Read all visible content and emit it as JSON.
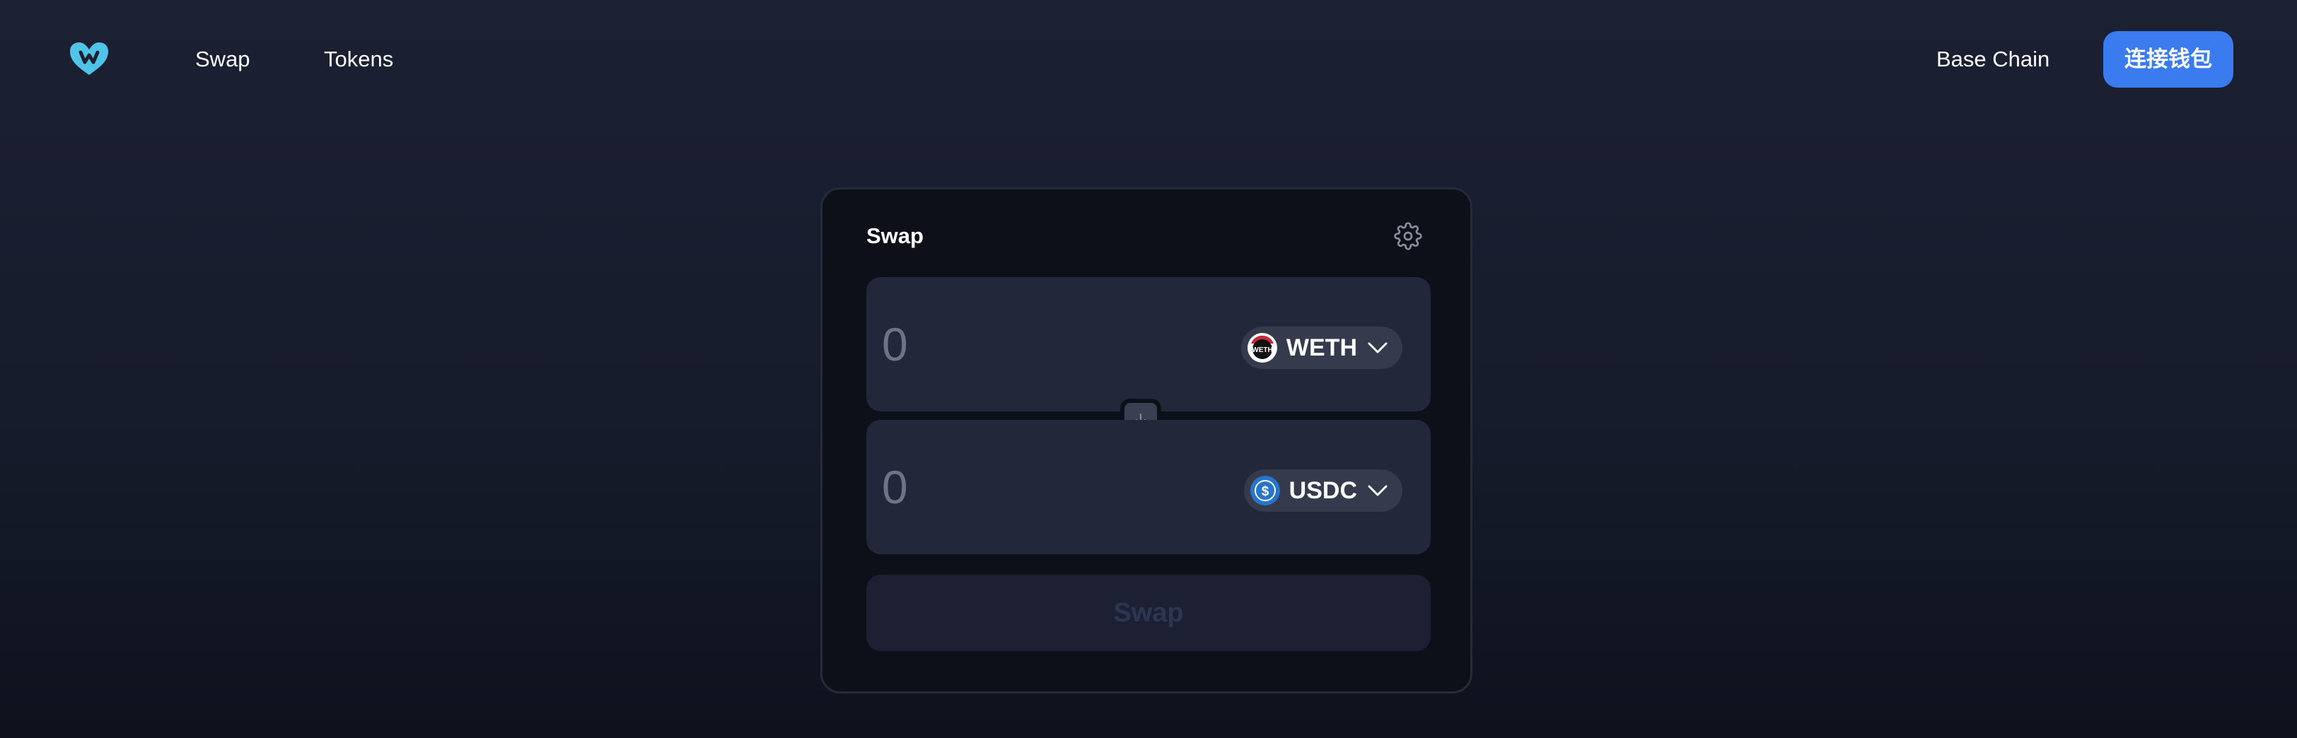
{
  "header": {
    "logo_icon": "heart-m-logo-icon",
    "nav": [
      {
        "label": "Swap"
      },
      {
        "label": "Tokens"
      }
    ],
    "chain_label": "Base Chain",
    "connect_label": "连接钱包"
  },
  "swap": {
    "title": "Swap",
    "settings_icon": "gear-icon",
    "from": {
      "amount_placeholder": "0",
      "token_symbol": "WETH",
      "token_icon_text": "WETH"
    },
    "to": {
      "amount_placeholder": "0",
      "token_symbol": "USDC",
      "token_icon_text": "$"
    },
    "flip_icon": "arrow-down-icon",
    "button_label": "Swap"
  },
  "colors": {
    "accent": "#3b7bf0",
    "logo": "#4fc3e8",
    "usdc": "#2775ca",
    "weth_ring": "#c8283c"
  }
}
